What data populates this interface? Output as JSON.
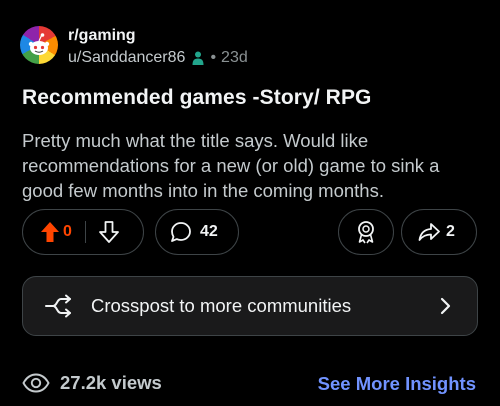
{
  "post": {
    "community": "r/gaming",
    "author": "u/Sanddancer86",
    "separator": "•",
    "age": "23d",
    "title": "Recommended games -Story/ RPG",
    "body": "Pretty much what the title says. Would like recommendations for a new (or old) game to sink a good few months into in the coming months."
  },
  "actions": {
    "vote_count": "0",
    "comment_count": "42",
    "share_count": "2"
  },
  "crosspost": {
    "label": "Crosspost to more communities"
  },
  "footer": {
    "views": "27.2k views",
    "insights_link": "See More Insights"
  },
  "icons": {
    "avatar": "rainbow-snoo-avatar",
    "moderator": "person-icon",
    "upvote": "upvote-arrow-icon",
    "downvote": "downvote-arrow-icon",
    "comment": "speech-bubble-icon",
    "award": "award-ribbon-icon",
    "share": "share-arrow-icon",
    "crosspost": "crosspost-icon",
    "chevron": "chevron-right-icon",
    "views": "eye-icon"
  },
  "colors": {
    "background": "#000000",
    "upvote_active": "#FF4500",
    "link": "#7193FF",
    "moderator": "#22A58C"
  }
}
